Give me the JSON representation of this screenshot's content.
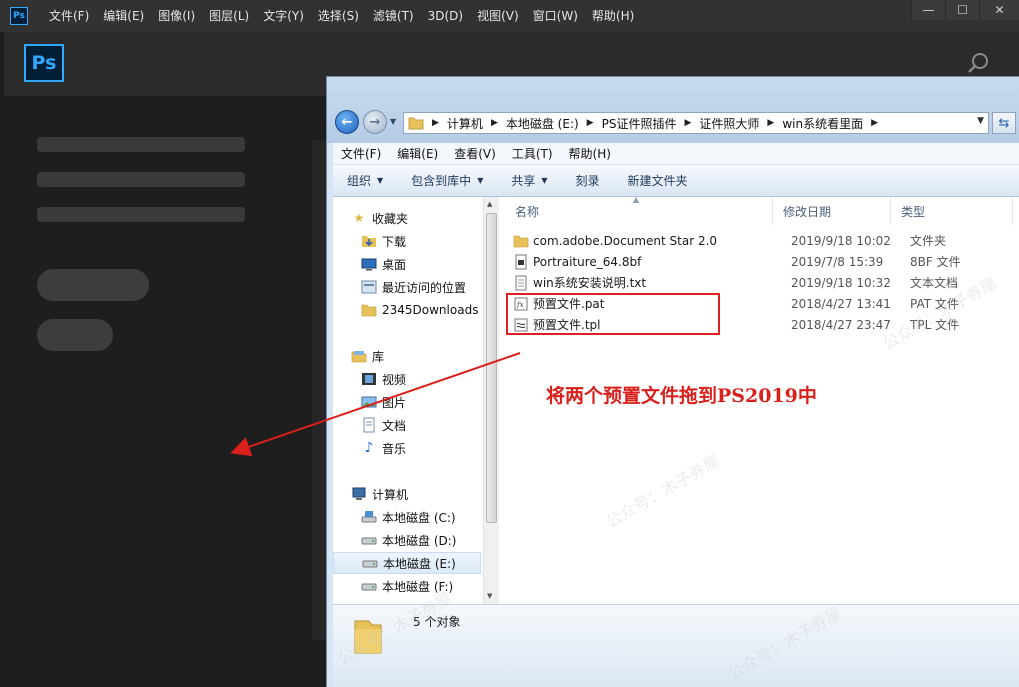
{
  "ps": {
    "small_logo": "Ps",
    "big_logo": "Ps",
    "menu": [
      "文件(F)",
      "编辑(E)",
      "图像(I)",
      "图层(L)",
      "文字(Y)",
      "选择(S)",
      "滤镜(T)",
      "3D(D)",
      "视图(V)",
      "窗口(W)",
      "帮助(H)"
    ],
    "window_controls": {
      "minimize": "—",
      "maximize": "☐",
      "close": "✕"
    },
    "accent_color": "#31a8ff"
  },
  "explorer": {
    "breadcrumb": [
      "计算机",
      "本地磁盘 (E:)",
      "PS证件照插件",
      "证件照大师",
      "win系统看里面"
    ],
    "menu": [
      "文件(F)",
      "编辑(E)",
      "查看(V)",
      "工具(T)",
      "帮助(H)"
    ],
    "toolbar": {
      "organize": "组织",
      "include_library": "包含到库中",
      "share": "共享",
      "burn": "刻录",
      "new_folder": "新建文件夹"
    },
    "nav": {
      "favorites_header": "收藏夹",
      "favorites": [
        "下载",
        "桌面",
        "最近访问的位置",
        "2345Downloads"
      ],
      "library_header": "库",
      "library": [
        "视频",
        "图片",
        "文档",
        "音乐"
      ],
      "computer_header": "计算机",
      "drives": [
        "本地磁盘 (C:)",
        "本地磁盘 (D:)",
        "本地磁盘 (E:)",
        "本地磁盘 (F:)"
      ]
    },
    "columns": {
      "name": "名称",
      "date": "修改日期",
      "type": "类型"
    },
    "files": [
      {
        "name": "com.adobe.Document Star 2.0",
        "date": "2019/9/18 10:02",
        "type": "文件夹",
        "icon": "folder-icon"
      },
      {
        "name": "Portraiture_64.8bf",
        "date": "2019/7/8 15:39",
        "type": "8BF 文件",
        "icon": "plugin-file-icon"
      },
      {
        "name": "win系统安装说明.txt",
        "date": "2019/9/18 10:32",
        "type": "文本文档",
        "icon": "text-file-icon"
      },
      {
        "name": "预置文件.pat",
        "date": "2018/4/27 13:41",
        "type": "PAT 文件",
        "icon": "pattern-file-icon"
      },
      {
        "name": "预置文件.tpl",
        "date": "2018/4/27 23:47",
        "type": "TPL 文件",
        "icon": "preset-file-icon"
      }
    ],
    "status": "5 个对象"
  },
  "annotation": {
    "text": "将两个预置文件拖到PS2019中",
    "color": "#d9201c"
  },
  "watermark": "公众号：木子券屋"
}
